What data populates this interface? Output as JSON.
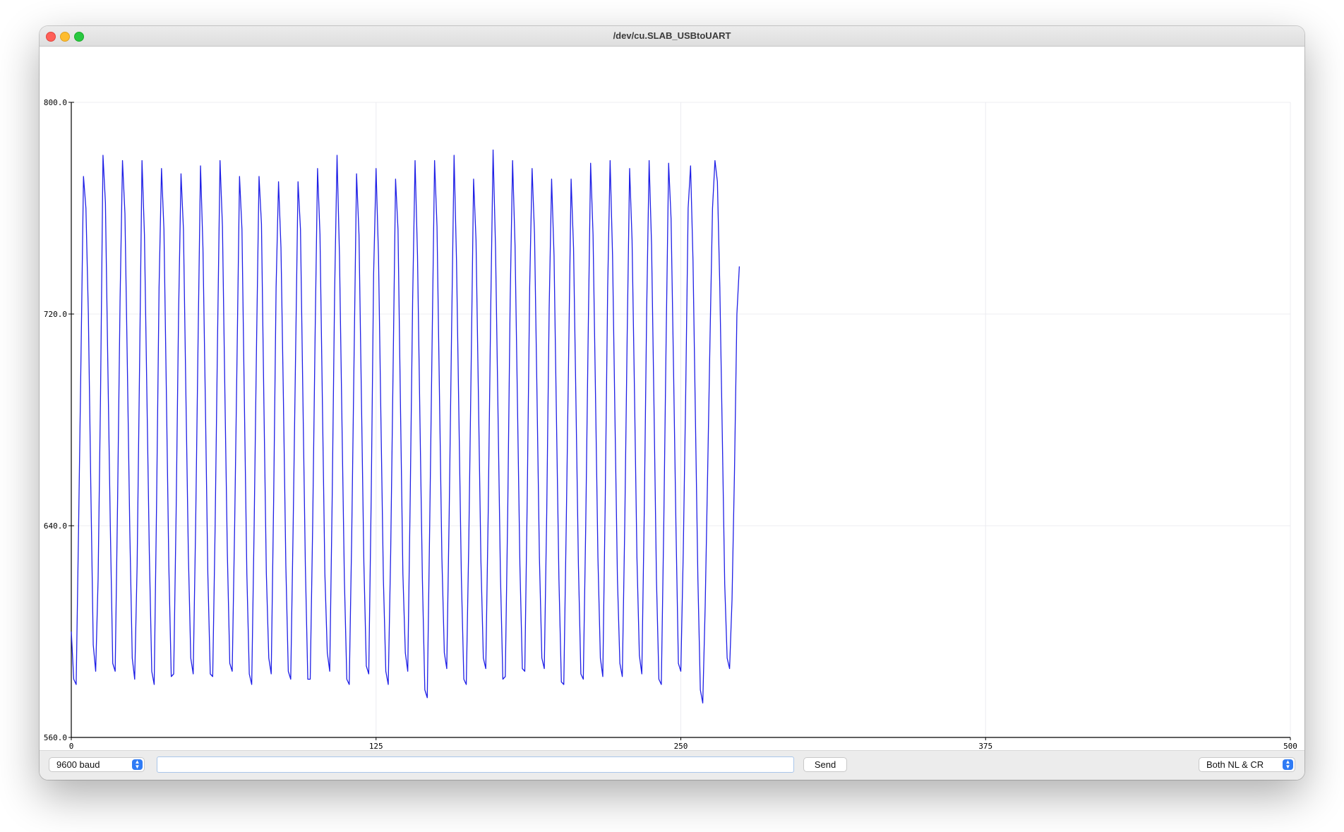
{
  "window": {
    "title": "/dev/cu.SLAB_USBtoUART"
  },
  "colors": {
    "series": "#1f1fe6",
    "axis": "#000000",
    "grid": "#ececf0",
    "accent": "#2f7bf5"
  },
  "chart_data": {
    "type": "line",
    "xlim": [
      0,
      500
    ],
    "ylim": [
      560,
      800
    ],
    "xticks": [
      0,
      125,
      250,
      375,
      500
    ],
    "yticks": [
      560,
      640,
      720,
      800
    ],
    "xtick_labels": [
      "0",
      "125",
      "250",
      "375",
      "500"
    ],
    "ytick_labels": [
      "560.0",
      "640.0",
      "720.0",
      "800.0"
    ],
    "grid": true,
    "series": [
      {
        "values": [
          600,
          582,
          580,
          640,
          705,
          772,
          760,
          720,
          655,
          595,
          585,
          620,
          690,
          780,
          762,
          700,
          640,
          588,
          585,
          650,
          725,
          778,
          758,
          700,
          638,
          590,
          582,
          625,
          700,
          778,
          750,
          690,
          630,
          585,
          580,
          650,
          730,
          775,
          752,
          690,
          625,
          583,
          584,
          645,
          720,
          773,
          752,
          690,
          630,
          590,
          584,
          640,
          710,
          776,
          745,
          686,
          622,
          584,
          583,
          640,
          712,
          778,
          753,
          690,
          630,
          588,
          585,
          640,
          705,
          772,
          752,
          686,
          622,
          584,
          580,
          640,
          710,
          772,
          754,
          686,
          622,
          590,
          584,
          650,
          730,
          770,
          745,
          688,
          625,
          585,
          582,
          640,
          705,
          770,
          752,
          688,
          625,
          582,
          582,
          640,
          712,
          775,
          750,
          686,
          622,
          592,
          585,
          650,
          728,
          780,
          742,
          680,
          620,
          582,
          580,
          635,
          705,
          773,
          750,
          688,
          626,
          587,
          584,
          650,
          735,
          775,
          742,
          680,
          620,
          585,
          580,
          630,
          700,
          771,
          752,
          686,
          622,
          592,
          585,
          650,
          725,
          778,
          742,
          680,
          620,
          578,
          575,
          640,
          710,
          778,
          753,
          690,
          628,
          592,
          586,
          645,
          715,
          780,
          740,
          680,
          620,
          582,
          580,
          632,
          700,
          771,
          748,
          688,
          627,
          590,
          586,
          645,
          720,
          782,
          745,
          684,
          622,
          582,
          583,
          645,
          725,
          778,
          746,
          686,
          625,
          586,
          585,
          650,
          730,
          775,
          750,
          690,
          628,
          590,
          586,
          645,
          722,
          771,
          742,
          680,
          620,
          581,
          580,
          640,
          705,
          771,
          745,
          686,
          625,
          584,
          582,
          640,
          712,
          777,
          750,
          690,
          628,
          590,
          583,
          650,
          730,
          778,
          742,
          680,
          620,
          588,
          583,
          640,
          712,
          775,
          748,
          690,
          628,
          591,
          584,
          645,
          722,
          778,
          746,
          685,
          620,
          582,
          580,
          640,
          712,
          777,
          756,
          700,
          640,
          588,
          585,
          630,
          690,
          760,
          776,
          740,
          680,
          620,
          578,
          573,
          610,
          660,
          712,
          760,
          778,
          770,
          730,
          675,
          618,
          590,
          586,
          612,
          660,
          720,
          738
        ]
      }
    ]
  },
  "toolbar": {
    "baud_rate": "9600 baud",
    "message_input_value": "",
    "message_input_placeholder": "",
    "send_label": "Send",
    "line_ending": "Both NL & CR"
  }
}
